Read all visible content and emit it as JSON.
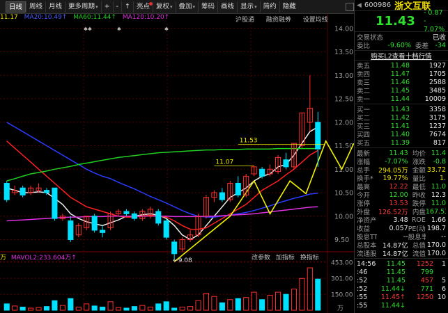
{
  "toolbar": {
    "items": [
      {
        "label": "日线",
        "active": true
      },
      {
        "label": "周线"
      },
      {
        "label": "月线"
      },
      {
        "label": "更多周期",
        "dropdown": true
      },
      {
        "label": "+"
      },
      {
        "label": "-"
      },
      {
        "label": "↑"
      },
      {
        "label": "亮点",
        "dot": true
      },
      {
        "label": "复权",
        "dropdown": true
      },
      {
        "label": "叠加",
        "dropdown": true
      },
      {
        "label": "筹码"
      },
      {
        "label": "画线"
      },
      {
        "label": "显示",
        "dropdown": true
      },
      {
        "label": "简约"
      },
      {
        "label": "隐藏"
      }
    ]
  },
  "ma_line": {
    "ma_prefix": "11.17",
    "ma20": "MA20:10.49↑",
    "ma60": "MA60:11.44↑",
    "ma120": "MA120:10.20↑"
  },
  "top_links": [
    "沪股通",
    "融资融券",
    "设置均线"
  ],
  "price_axis": [
    "14.00",
    "13.50",
    "13.00",
    "12.50",
    "12.00",
    "11.50",
    "11.00",
    "10.50",
    "10.00",
    "9.50"
  ],
  "volume_axis": [
    "453.00",
    "301.00",
    "150.00"
  ],
  "volume_unit": "万",
  "volume_header": {
    "prefix": "万",
    "mavol": "MAVOL2:233.604万↑",
    "links": [
      "改参数",
      "加指标",
      "换指标"
    ]
  },
  "annotations": {
    "high_11_53": "11.53",
    "high_11_07": "11.07",
    "low_9_08": "←9.08"
  },
  "stock": {
    "code": "600986",
    "name": "浙文互联",
    "price": "11.43",
    "change": "- 0.87",
    "change_pct": "- 7.07%",
    "status_label": "交易状态",
    "status_value": "已收",
    "weibi_label": "委比",
    "weibi_value": "-9.60%",
    "weicha_label": "委差",
    "weicha_value": "-34",
    "l2_link": "购买L2查看十档行情"
  },
  "sell_orders": [
    {
      "label": "卖五",
      "price": "11.48",
      "vol": "1927"
    },
    {
      "label": "卖四",
      "price": "11.47",
      "vol": "1705"
    },
    {
      "label": "卖三",
      "price": "11.46",
      "vol": "2588"
    },
    {
      "label": "卖二",
      "price": "11.45",
      "vol": "3485"
    },
    {
      "label": "卖一",
      "price": "11.44",
      "vol": "10009"
    }
  ],
  "buy_orders": [
    {
      "label": "买一",
      "price": "11.43",
      "vol": "3358"
    },
    {
      "label": "买二",
      "price": "11.42",
      "vol": "3175"
    },
    {
      "label": "买三",
      "price": "11.41",
      "vol": "1237"
    },
    {
      "label": "买四",
      "price": "11.40",
      "vol": "7674"
    },
    {
      "label": "买五",
      "price": "11.39",
      "vol": "817"
    }
  ],
  "stats": [
    {
      "l1": "最新",
      "v1": "11.43",
      "c1": "green",
      "l2": "均价",
      "v2": "11.4",
      "c2": "green"
    },
    {
      "l1": "涨幅",
      "v1": "-7.07%",
      "c1": "green",
      "l2": "涨跌",
      "v2": "-0.8",
      "c2": "green"
    },
    {
      "l1": "总手",
      "v1": "294.05万",
      "c1": "yellow",
      "l2": "金额",
      "v2": "33.72",
      "c2": "yellow"
    },
    {
      "l1": "换手*",
      "v1": "19.77%",
      "c1": "yellow",
      "l2": "量比",
      "v2": "1.",
      "c2": "yellow"
    },
    {
      "l1": "最高",
      "v1": "12.22",
      "c1": "red",
      "l2": "最低",
      "v2": "11.0",
      "c2": "green"
    },
    {
      "l1": "今开",
      "v1": "12.00",
      "c1": "green",
      "l2": "昨收",
      "v2": "12.3",
      "c2": "white"
    },
    {
      "l1": "涨停",
      "v1": "13.53",
      "c1": "red",
      "l2": "跌停",
      "v2": "11.0",
      "c2": "green"
    },
    {
      "l1": "外盘",
      "v1": "126.52万",
      "c1": "red",
      "l2": "内盘",
      "v2": "167.53",
      "c2": "green"
    },
    {
      "l1": "净资产",
      "v1": "3.48",
      "c1": "white",
      "l2": "ROE",
      "v2": "1.66",
      "c2": "white"
    },
    {
      "l1": "收益",
      "v1": "0.057",
      "c1": "white",
      "l2": "PE(动)",
      "v2": "198.7",
      "c2": "white"
    },
    {
      "l1": "股息TTM",
      "v1": "--",
      "c1": "white",
      "l2": "股息率",
      "v2": "--",
      "c2": "white"
    },
    {
      "l1": "总股本",
      "v1": "14.87亿",
      "c1": "white",
      "l2": "总值",
      "v2": "170.0",
      "c2": "white"
    },
    {
      "l1": "流通股",
      "v1": "14.87亿",
      "c1": "white",
      "l2": "流值",
      "v2": "170.0",
      "c2": "white"
    }
  ],
  "ticks": [
    {
      "time": "14:56",
      "price": "11.45",
      "pc": "green",
      "vol": "1252",
      "vc": "red",
      "tail": "1"
    },
    {
      "time": ":46",
      "price": "11.45",
      "pc": "green",
      "vol": "799",
      "vc": "green",
      "tail": ""
    },
    {
      "time": ":52",
      "price": "11.45",
      "pc": "green",
      "vol": "457",
      "vc": "red",
      "tail": "5"
    },
    {
      "time": ":52",
      "price": "11.44↓",
      "pc": "green",
      "vol": "771",
      "vc": "green",
      "tail": "6"
    },
    {
      "time": ":55",
      "price": "11.45↑",
      "pc": "red",
      "vol": "1250",
      "vc": "red",
      "tail": "10"
    },
    {
      "time": ":55",
      "price": "11.44↓",
      "pc": "green",
      "vol": "",
      "vc": "green",
      "tail": ""
    }
  ],
  "chart_data": {
    "type": "candlestick",
    "y_range": [
      9.3,
      14.1
    ],
    "candles": [
      {
        "o": 10.7,
        "c": 10.35,
        "h": 10.75,
        "l": 10.3
      },
      {
        "o": 10.5,
        "c": 10.55,
        "h": 10.65,
        "l": 10.45
      },
      {
        "o": 10.6,
        "c": 10.45,
        "h": 10.65,
        "l": 10.4
      },
      {
        "o": 10.5,
        "c": 10.6,
        "h": 10.65,
        "l": 10.45
      },
      {
        "o": 10.55,
        "c": 10.6,
        "h": 10.7,
        "l": 10.5
      },
      {
        "o": 10.55,
        "c": 10.5,
        "h": 10.6,
        "l": 10.45
      },
      {
        "o": 10.6,
        "c": 9.95,
        "h": 10.6,
        "l": 9.9
      },
      {
        "o": 9.95,
        "c": 10.0,
        "h": 10.05,
        "l": 9.9
      },
      {
        "o": 9.9,
        "c": 9.5,
        "h": 10.0,
        "l": 9.45
      },
      {
        "o": 9.6,
        "c": 9.8,
        "h": 9.85,
        "l": 9.55
      },
      {
        "o": 9.75,
        "c": 10.0,
        "h": 10.0,
        "l": 9.7
      },
      {
        "o": 10.0,
        "c": 9.7,
        "h": 10.05,
        "l": 9.65
      },
      {
        "o": 9.7,
        "c": 9.65,
        "h": 9.8,
        "l": 9.55
      },
      {
        "o": 9.75,
        "c": 10.05,
        "h": 10.1,
        "l": 9.7
      },
      {
        "o": 10.05,
        "c": 10.1,
        "h": 10.15,
        "l": 10.0
      },
      {
        "o": 10.1,
        "c": 10.05,
        "h": 10.15,
        "l": 10.0
      },
      {
        "o": 10.05,
        "c": 9.95,
        "h": 10.1,
        "l": 9.9
      },
      {
        "o": 9.95,
        "c": 10.1,
        "h": 10.15,
        "l": 9.9
      },
      {
        "o": 10.0,
        "c": 10.15,
        "h": 10.2,
        "l": 9.95
      },
      {
        "o": 10.1,
        "c": 9.85,
        "h": 10.15,
        "l": 9.8
      },
      {
        "o": 9.9,
        "c": 9.55,
        "h": 9.95,
        "l": 9.5
      },
      {
        "o": 9.45,
        "c": 9.2,
        "h": 9.5,
        "l": 9.08
      },
      {
        "o": 9.3,
        "c": 9.5,
        "h": 9.55,
        "l": 9.25
      },
      {
        "o": 9.5,
        "c": 9.6,
        "h": 9.7,
        "l": 9.45
      },
      {
        "o": 9.6,
        "c": 10.0,
        "h": 10.05,
        "l": 9.55
      },
      {
        "o": 10.0,
        "c": 10.4,
        "h": 10.45,
        "l": 9.95
      },
      {
        "o": 10.4,
        "c": 10.5,
        "h": 10.55,
        "l": 10.3
      },
      {
        "o": 10.5,
        "c": 10.35,
        "h": 10.6,
        "l": 10.3
      },
      {
        "o": 10.35,
        "c": 10.7,
        "h": 10.75,
        "l": 10.3
      },
      {
        "o": 10.7,
        "c": 10.45,
        "h": 10.85,
        "l": 10.4
      },
      {
        "o": 10.45,
        "c": 10.85,
        "h": 10.9,
        "l": 10.4
      },
      {
        "o": 10.9,
        "c": 11.05,
        "h": 11.07,
        "l": 10.85
      },
      {
        "o": 11.0,
        "c": 10.85,
        "h": 11.05,
        "l": 10.8
      },
      {
        "o": 10.9,
        "c": 11.0,
        "h": 11.1,
        "l": 10.85
      },
      {
        "o": 10.95,
        "c": 11.25,
        "h": 11.3,
        "l": 10.9
      },
      {
        "o": 11.2,
        "c": 11.05,
        "h": 11.35,
        "l": 11.0
      },
      {
        "o": 11.05,
        "c": 11.55,
        "h": 11.55,
        "l": 11.0
      },
      {
        "o": 11.5,
        "c": 12.2,
        "h": 12.2,
        "l": 11.45
      },
      {
        "o": 12.0,
        "c": 12.3,
        "h": 13.0,
        "l": 11.8
      },
      {
        "o": 12.0,
        "c": 11.43,
        "h": 12.22,
        "l": 11.05
      }
    ],
    "volume": [
      60,
      40,
      30,
      20,
      25,
      35,
      90,
      45,
      110,
      30,
      60,
      40,
      30,
      80,
      25,
      20,
      35,
      45,
      30,
      60,
      80,
      20,
      30,
      35,
      90,
      160,
      130,
      70,
      100,
      110,
      120,
      170,
      100,
      140,
      170,
      150,
      200,
      300,
      400,
      294
    ],
    "ma_series": {
      "MA5": [
        10.6,
        10.55,
        10.5,
        10.5,
        10.52,
        10.5,
        10.38,
        10.25,
        10.05,
        9.95,
        9.88,
        9.84,
        9.8,
        9.86,
        9.92,
        10.0,
        10.0,
        10.03,
        10.05,
        10.02,
        9.95,
        9.8,
        9.6,
        9.5,
        9.6,
        9.8,
        10.0,
        10.2,
        10.4,
        10.5,
        10.6,
        10.75,
        10.85,
        10.9,
        11.05,
        11.1,
        11.3,
        11.55,
        11.8,
        11.9
      ],
      "MA10": [
        11.6,
        11.45,
        11.3,
        11.15,
        11.0,
        10.85,
        10.7,
        10.55,
        10.4,
        10.3,
        10.2,
        10.15,
        10.1,
        10.05,
        10.0,
        9.98,
        9.98,
        10.0,
        10.02,
        10.0,
        9.98,
        9.9,
        9.8,
        9.72,
        9.72,
        9.75,
        9.85,
        9.95,
        10.05,
        10.15,
        10.25,
        10.4,
        10.55,
        10.65,
        10.75,
        10.88,
        11.0,
        11.15,
        11.3,
        11.4
      ],
      "MA20": [
        12.0,
        11.9,
        11.8,
        11.7,
        11.6,
        11.5,
        11.4,
        11.3,
        11.2,
        11.1,
        11.0,
        10.92,
        10.85,
        10.8,
        10.72,
        10.65,
        10.58,
        10.5,
        10.42,
        10.35,
        10.28,
        10.2,
        10.12,
        10.05,
        10.0,
        9.98,
        9.98,
        10.0,
        10.02,
        10.05,
        10.08,
        10.12,
        10.17,
        10.22,
        10.28,
        10.33,
        10.38,
        10.42,
        10.47,
        10.49
      ],
      "MA60": [
        10.75,
        10.8,
        10.85,
        10.9,
        10.93,
        10.96,
        11.0,
        11.03,
        11.06,
        11.1,
        11.13,
        11.16,
        11.19,
        11.22,
        11.25,
        11.27,
        11.29,
        11.31,
        11.33,
        11.35,
        11.36,
        11.37,
        11.38,
        11.39,
        11.4,
        11.41,
        11.41,
        11.42,
        11.42,
        11.42,
        11.43,
        11.43,
        11.43,
        11.43,
        11.44,
        11.44,
        11.44,
        11.44,
        11.44,
        11.44
      ],
      "MA120": [
        9.9,
        9.91,
        9.92,
        9.93,
        9.94,
        9.95,
        9.96,
        9.97,
        9.98,
        9.98,
        9.99,
        9.99,
        9.99,
        10.0,
        10.0,
        10.0,
        10.0,
        10.0,
        10.0,
        10.0,
        10.0,
        9.99,
        9.99,
        9.99,
        9.99,
        10.0,
        10.0,
        10.01,
        10.02,
        10.03,
        10.04,
        10.05,
        10.07,
        10.09,
        10.11,
        10.13,
        10.15,
        10.17,
        10.19,
        10.2
      ]
    },
    "ma_colors": {
      "MA5": "#f0f0f0",
      "MA10": "#ff2020",
      "MA20": "#2a3cff",
      "MA60": "#20d020",
      "MA120": "#e030e0"
    },
    "yellow_line": [
      [
        21.5,
        9.03
      ],
      [
        28.5,
        10.0
      ],
      [
        31.5,
        10.75
      ],
      [
        33.5,
        10.05
      ],
      [
        36.0,
        10.75
      ],
      [
        38.0,
        10.48
      ],
      [
        40.5,
        11.6
      ],
      [
        42.5,
        11.0
      ],
      [
        44.0,
        11.55
      ]
    ]
  },
  "colors": {
    "up": "#ff3030",
    "down": "#00e0ff",
    "grid": "#5a0000",
    "axis_text": "#9a9a9a"
  }
}
